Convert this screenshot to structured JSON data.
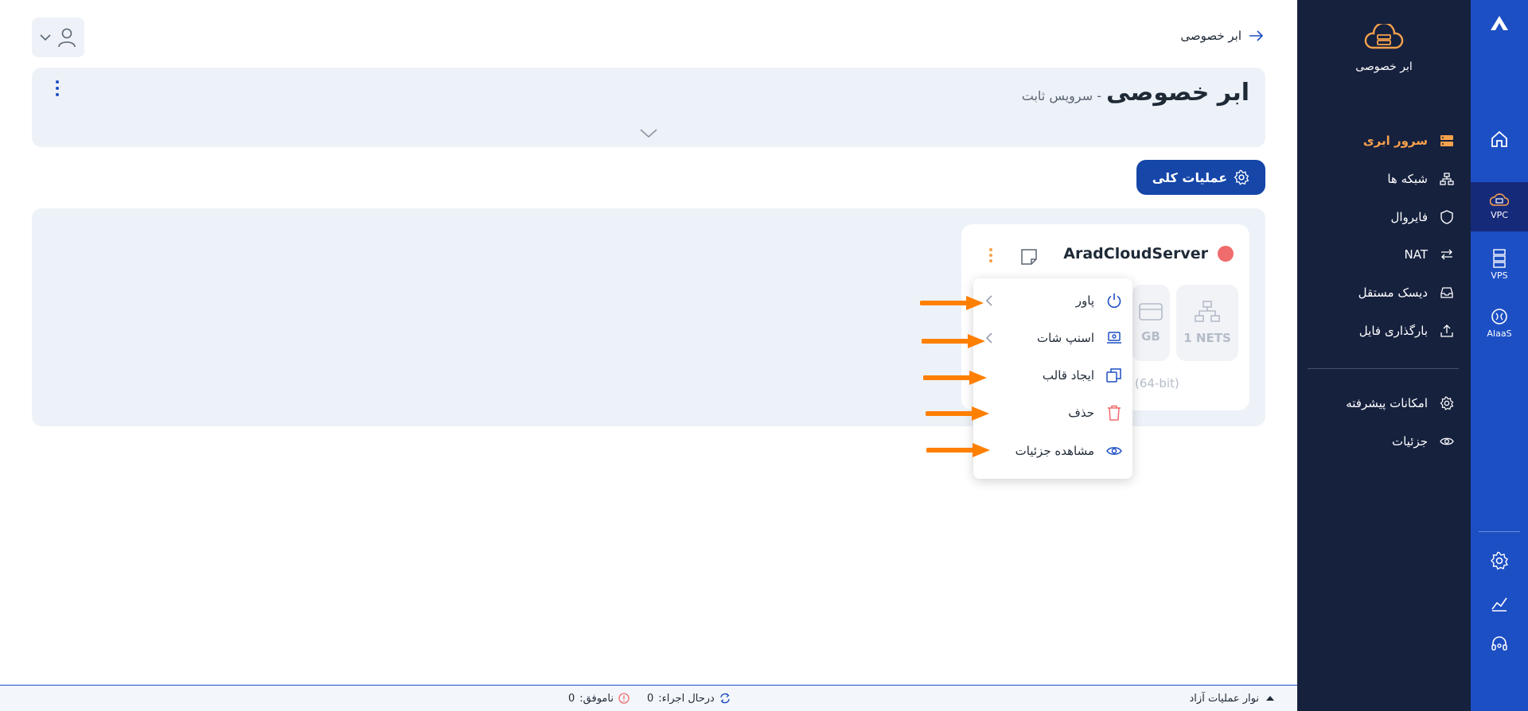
{
  "rail": {
    "items": [
      {
        "label": "VPC",
        "icon": "cloud-server-icon"
      },
      {
        "label": "VPS",
        "icon": "server-stack-icon"
      },
      {
        "label": "AIaaS",
        "icon": "ai-brain-icon"
      }
    ]
  },
  "sidebar": {
    "service_title": "ابر خصوصی",
    "items": [
      {
        "label": "سرور ابری",
        "icon": "server-icon",
        "active": true
      },
      {
        "label": "شبکه ها",
        "icon": "network-icon"
      },
      {
        "label": "فایروال",
        "icon": "shield-icon"
      },
      {
        "label": "NAT",
        "icon": "nat-arrows-icon"
      },
      {
        "label": "دیسک مستقل",
        "icon": "disk-icon"
      },
      {
        "label": "بارگذاری فایل",
        "icon": "upload-icon"
      },
      {
        "label": "امکانات پیشرفته",
        "icon": "gear-icon"
      },
      {
        "label": "جزئیات",
        "icon": "eye-icon"
      }
    ]
  },
  "header": {
    "back_label": "ابر خصوصی",
    "title": "ابر خصوصی",
    "subtitle": "- سرویس ثابت"
  },
  "ops_button": {
    "label": "عملیات کلی"
  },
  "server": {
    "name": "AradCloudServer",
    "status_color": "#f06b6b",
    "nets": "1 NETS",
    "gb": "GB",
    "arch": "(64-bit)"
  },
  "context_menu": {
    "items": [
      {
        "label": "پاور",
        "icon": "power-icon",
        "submenu": true
      },
      {
        "label": "اسنپ شات",
        "icon": "snapshot-icon",
        "submenu": true
      },
      {
        "label": "ایجاد قالب",
        "icon": "template-icon",
        "submenu": false
      },
      {
        "label": "حذف",
        "icon": "trash-icon",
        "submenu": false
      },
      {
        "label": "مشاهده جزئیات",
        "icon": "eye-icon",
        "submenu": false
      }
    ]
  },
  "footer": {
    "bar_title": "نوار عملیات آزاد",
    "running_label": "درحال اجراء:",
    "running_count": "0",
    "failed_label": "ناموفق:",
    "failed_count": "0"
  },
  "colors": {
    "rail": "#1d4fc4",
    "sidebar": "#16213e",
    "accent": "#f7a14c",
    "primary_button": "#1546a8",
    "arrow": "#ff7f00"
  }
}
